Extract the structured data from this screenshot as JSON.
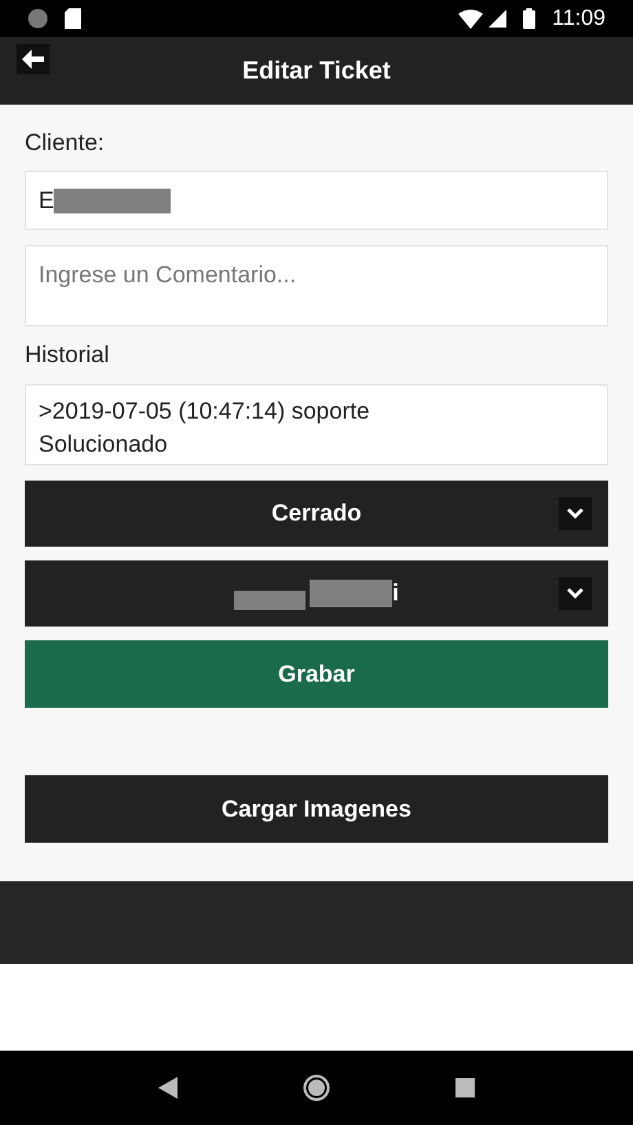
{
  "status_bar": {
    "time": "11:09"
  },
  "header": {
    "title": "Editar Ticket"
  },
  "form": {
    "client_label": "Cliente:",
    "client_value": "E",
    "client_redacted": true,
    "comment": {
      "placeholder": "Ingrese un Comentario..."
    },
    "history_label": "Historial",
    "history_value": ">2019-07-05 (10:47:14) soporte\nSolucionado",
    "selects": [
      {
        "value": "Cerrado",
        "redacted": false
      },
      {
        "value": "i",
        "redacted": true
      }
    ],
    "buttons": [
      {
        "label": "Grabar",
        "kind": "primary"
      },
      {
        "label": "Cargar Imagenes",
        "kind": "dark"
      }
    ]
  }
}
